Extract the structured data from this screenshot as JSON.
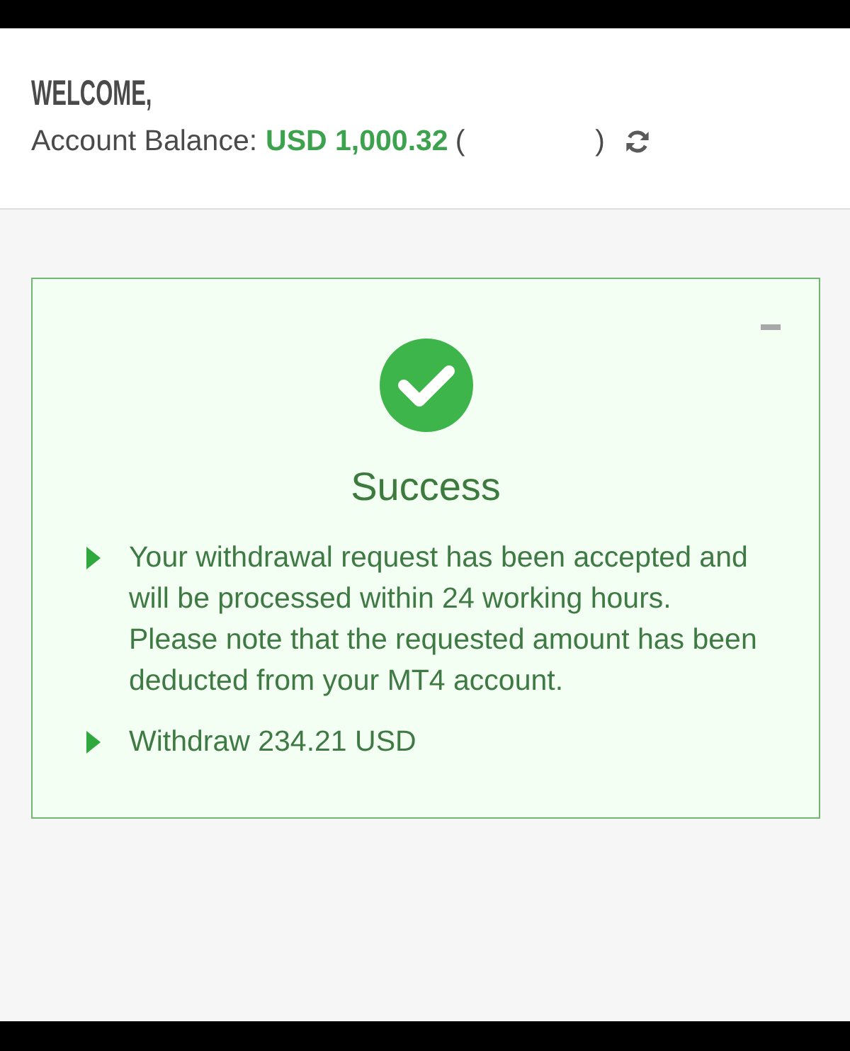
{
  "header": {
    "greeting": "WELCOME,",
    "balance_label": "Account Balance:",
    "balance_amount": "USD 1,000.32",
    "note_open": "(",
    "note_close": ")"
  },
  "card": {
    "expanded": true,
    "title": "Success",
    "items": [
      {
        "lines": [
          "Your withdrawal request has been accepted and will be processed within 24 working hours.",
          "Please note that the requested amount has been deducted from your MT4 account."
        ]
      },
      {
        "lines": [
          "Withdraw 234.21 USD"
        ]
      }
    ]
  }
}
